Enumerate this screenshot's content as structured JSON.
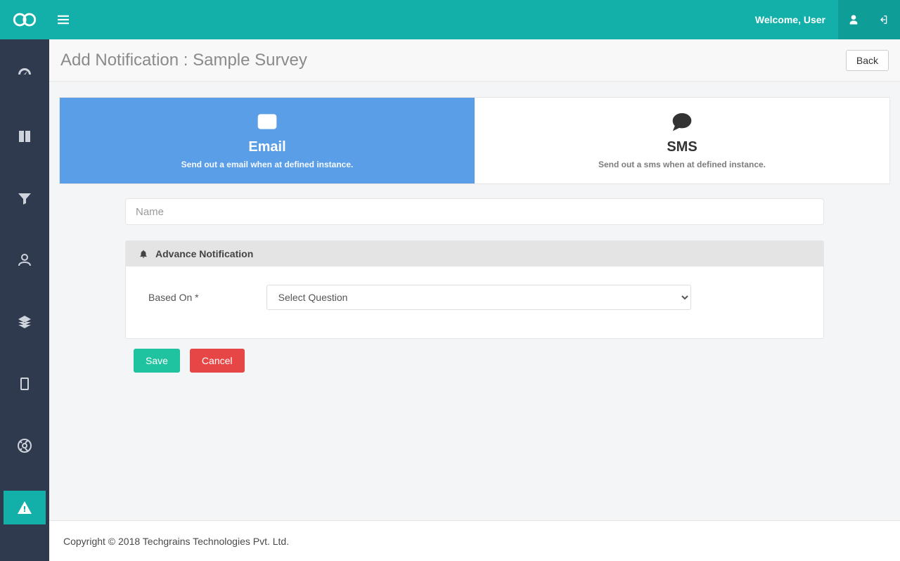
{
  "header": {
    "welcome_text": "Welcome, User"
  },
  "page": {
    "title": "Add Notification : Sample Survey",
    "back_label": "Back"
  },
  "tabs": {
    "email": {
      "title": "Email",
      "desc": "Send out a email when at defined instance."
    },
    "sms": {
      "title": "SMS",
      "desc": "Send out a sms when at defined instance."
    }
  },
  "form": {
    "name_placeholder": "Name",
    "panel_title": "Advance Notification",
    "based_on_label": "Based On *",
    "select_placeholder": "Select Question",
    "save_label": "Save",
    "cancel_label": "Cancel"
  },
  "footer": {
    "text": "Copyright © 2018 Techgrains Technologies Pvt. Ltd."
  }
}
